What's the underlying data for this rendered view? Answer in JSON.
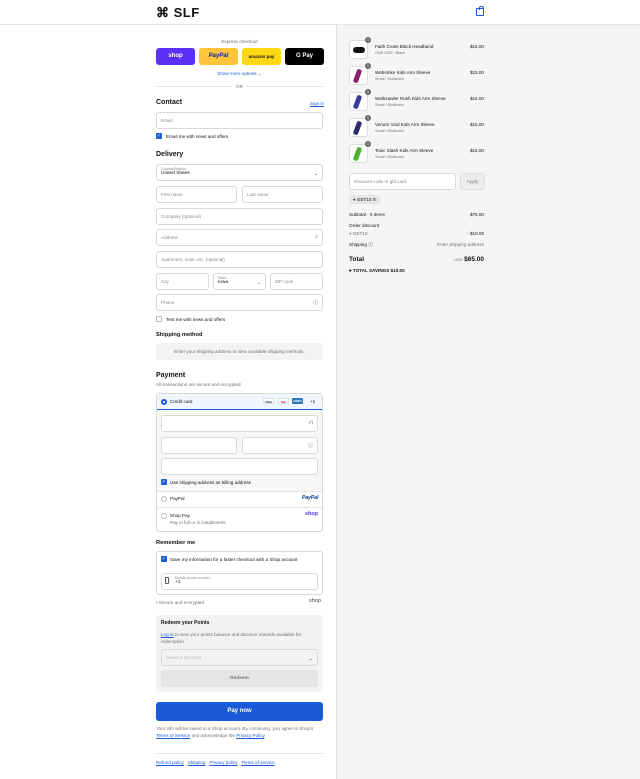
{
  "header": {
    "logo": "SLF",
    "logo_mark": "⌘"
  },
  "express": {
    "label": "Express checkout",
    "buttons": [
      {
        "label": "shop",
        "bg": "#5a31f4",
        "color": "#ffffff"
      },
      {
        "label": "PayPal",
        "bg": "#ffc439",
        "color": "#003087"
      },
      {
        "label": "amazon pay",
        "bg": "#ffd814",
        "color": "#111111"
      },
      {
        "label": "G Pay",
        "bg": "#000000",
        "color": "#ffffff"
      }
    ],
    "more": "Show more options ⌄",
    "or": "OR"
  },
  "contact": {
    "title": "Contact",
    "signin": "Sign in",
    "email_placeholder": "Email",
    "email_news": "Email me with news and offers"
  },
  "delivery": {
    "title": "Delivery",
    "country_label": "Country/Region",
    "country_value": "United States",
    "first_name": "First name",
    "last_name": "Last name",
    "company": "Company (optional)",
    "address": "Address",
    "apartment": "Apartment, suite, etc. (optional)",
    "city": "City",
    "state_label": "State",
    "state_value": "Iowa",
    "zip": "ZIP code",
    "phone": "Phone",
    "text_news": "Text me with news and offers"
  },
  "shipping": {
    "title": "Shipping method",
    "note": "Enter your shipping address to view available shipping methods."
  },
  "payment": {
    "title": "Payment",
    "subtitle": "All transactions are secure and encrypted.",
    "credit_card": "Credit card",
    "card_badges": [
      "VISA",
      "MC",
      "AMEX"
    ],
    "more_cards": "+1",
    "billing_same": "Use shipping address as billing address",
    "paypal": "PayPal",
    "paypal_logo": "PayPal",
    "shoppay": "Shop Pay",
    "shoppay_sub": "Pay in full or in installments",
    "shoppay_logo": "shop"
  },
  "remember": {
    "title": "Remember me",
    "save_info": "Save my information for a faster checkout with a Shop account",
    "mobile_label": "Mobile phone number",
    "mobile_prefix": "+1",
    "secure": "Secure and encrypted",
    "shop_logo": "shop"
  },
  "points": {
    "title": "Redeem your Points",
    "text_link": "Log in",
    "text_rest": " to view your points balance and discover rewards available for redemption.",
    "select_placeholder": "Select a discount",
    "redeem_button": "Redeem"
  },
  "pay_now": "Pay now",
  "legal": {
    "line1": "Your info will be saved to a Shop account. By continuing, you agree to Shop's",
    "tos": "Terms of Service",
    "and": " and acknowledge the ",
    "privacy": "Privacy Policy",
    "end": "."
  },
  "footer_links": [
    "Refund policy",
    "Shipping",
    "Privacy policy",
    "Terms of service"
  ],
  "cart": {
    "items": [
      {
        "name": "Faith Cross Black Headband",
        "variant": "ONE SIZE / Black",
        "price": "$15.00",
        "qty": "1",
        "color": "#111111"
      },
      {
        "name": "Webstrike Kids Arm Sleeve",
        "variant": "Small / Multicolor",
        "price": "$15.00",
        "qty": "1",
        "color": "#8b1e6b"
      },
      {
        "name": "Wallcrawler Rush Kids Arm Sleeve",
        "variant": "Small / Multicolor",
        "price": "$15.00",
        "qty": "1",
        "color": "#3b3b9e"
      },
      {
        "name": "Venom Void Kids Arm Sleeve",
        "variant": "Small / Multicolor",
        "price": "$15.00",
        "qty": "1",
        "color": "#2a2a6e"
      },
      {
        "name": "Toxic Slash Kids Arm Sleeve",
        "variant": "Small / Multicolor",
        "price": "$15.00",
        "qty": "1",
        "color": "#46b52f"
      }
    ],
    "discount_placeholder": "Discount code or gift card",
    "apply": "Apply",
    "code_tag": "GET10",
    "subtotal_label": "Subtotal · 5 items",
    "subtotal_value": "$75.00",
    "order_discount": "Order discount",
    "discount_code": "GET10",
    "discount_value": "- $10.00",
    "shipping_label": "Shipping",
    "shipping_value": "Enter shipping address",
    "total_label": "Total",
    "currency": "USD",
    "total_value": "$65.00",
    "savings_label": "TOTAL SAVINGS",
    "savings_value": "$10.00"
  }
}
